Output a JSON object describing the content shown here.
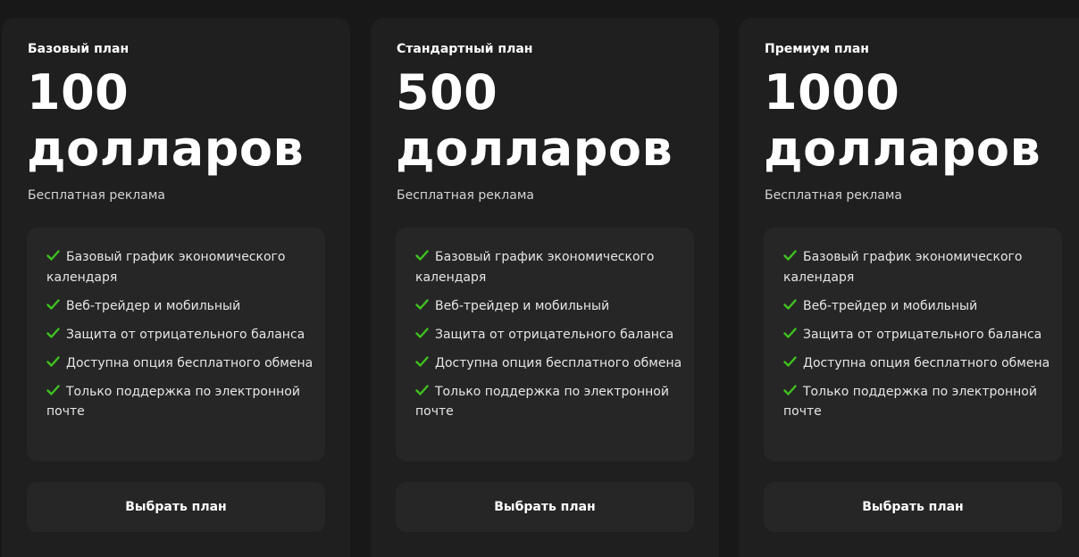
{
  "plans": [
    {
      "name": "Базовый план",
      "price_amount": "100",
      "price_unit": "долларов",
      "subtitle": "Бесплатная реклама",
      "features": [
        "Базовый график экономического календаря",
        "Веб-трейдер и мобильный",
        "Защита от отрицательного баланса",
        "Доступна опция бесплатного обмена",
        "Только поддержка по электронной почте"
      ],
      "button_label": "Выбрать план"
    },
    {
      "name": "Стандартный план",
      "price_amount": "500",
      "price_unit": "долларов",
      "subtitle": "Бесплатная реклама",
      "features": [
        "Базовый график экономического календаря",
        "Веб-трейдер и мобильный",
        "Защита от отрицательного баланса",
        "Доступна опция бесплатного обмена",
        "Только поддержка по электронной почте"
      ],
      "button_label": "Выбрать план"
    },
    {
      "name": "Премиум план",
      "price_amount": "1000",
      "price_unit": "долларов",
      "subtitle": "Бесплатная реклама",
      "features": [
        "Базовый график экономического календаря",
        "Веб-трейдер и мобильный",
        "Защита от отрицательного баланса",
        "Доступна опция бесплатного обмена",
        "Только поддержка по электронной почте"
      ],
      "button_label": "Выбрать план"
    }
  ],
  "feature_icon": "checkmark-icon",
  "colors": {
    "background": "#181818",
    "card": "#1f1f1f",
    "panel": "#262626",
    "check": "#3fc11f",
    "text": "#ffffff"
  }
}
